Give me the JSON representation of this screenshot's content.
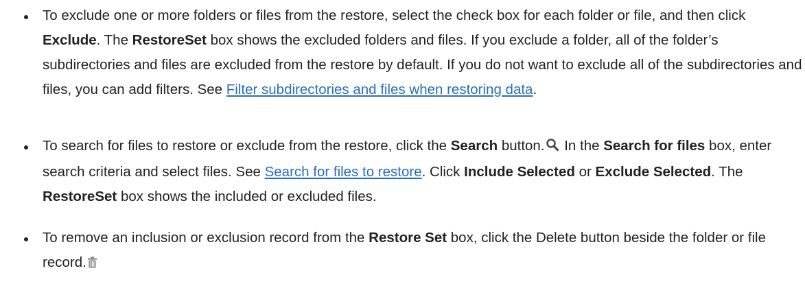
{
  "bullets": [
    {
      "t1": "To exclude one or more folders or files from the restore, select the check box for each folder or file, and then click ",
      "b1": "Exclude",
      "t2": ". The ",
      "b2": "RestoreSet",
      "t3": " box shows the excluded folders and files. If you exclude a folder, all of the folder’s subdirectories and files are excluded from the restore by default. If you do not want to exclude all of the subdirectories and files, you can add filters. See ",
      "link": "Filter subdirectories and files when restoring data",
      "t4": "."
    },
    {
      "t1": "To search for files to restore or exclude from the restore, click the ",
      "b1": "Search",
      "t2": " button.",
      "icon": "search-icon",
      "t3": " In the ",
      "b2": "Search for files",
      "t4": " box, enter search criteria and select files. See ",
      "link": "Search for files to restore",
      "t5": ". Click ",
      "b3": "Include Selected",
      "t6": " or ",
      "b4": "Exclude Selected",
      "t7": ". The ",
      "b5": "RestoreSet",
      "t8": " box shows the included or excluded files."
    },
    {
      "t1": "To remove an inclusion or exclusion record from the ",
      "b1": "Restore Set",
      "t2": " box, click the Delete button beside the folder or file record.",
      "icon": "trash-icon"
    }
  ],
  "colors": {
    "text": "#222222",
    "link": "#2a6ebb",
    "search_icon": "#4a4a4a",
    "trash_icon": "#8a8a8a"
  }
}
